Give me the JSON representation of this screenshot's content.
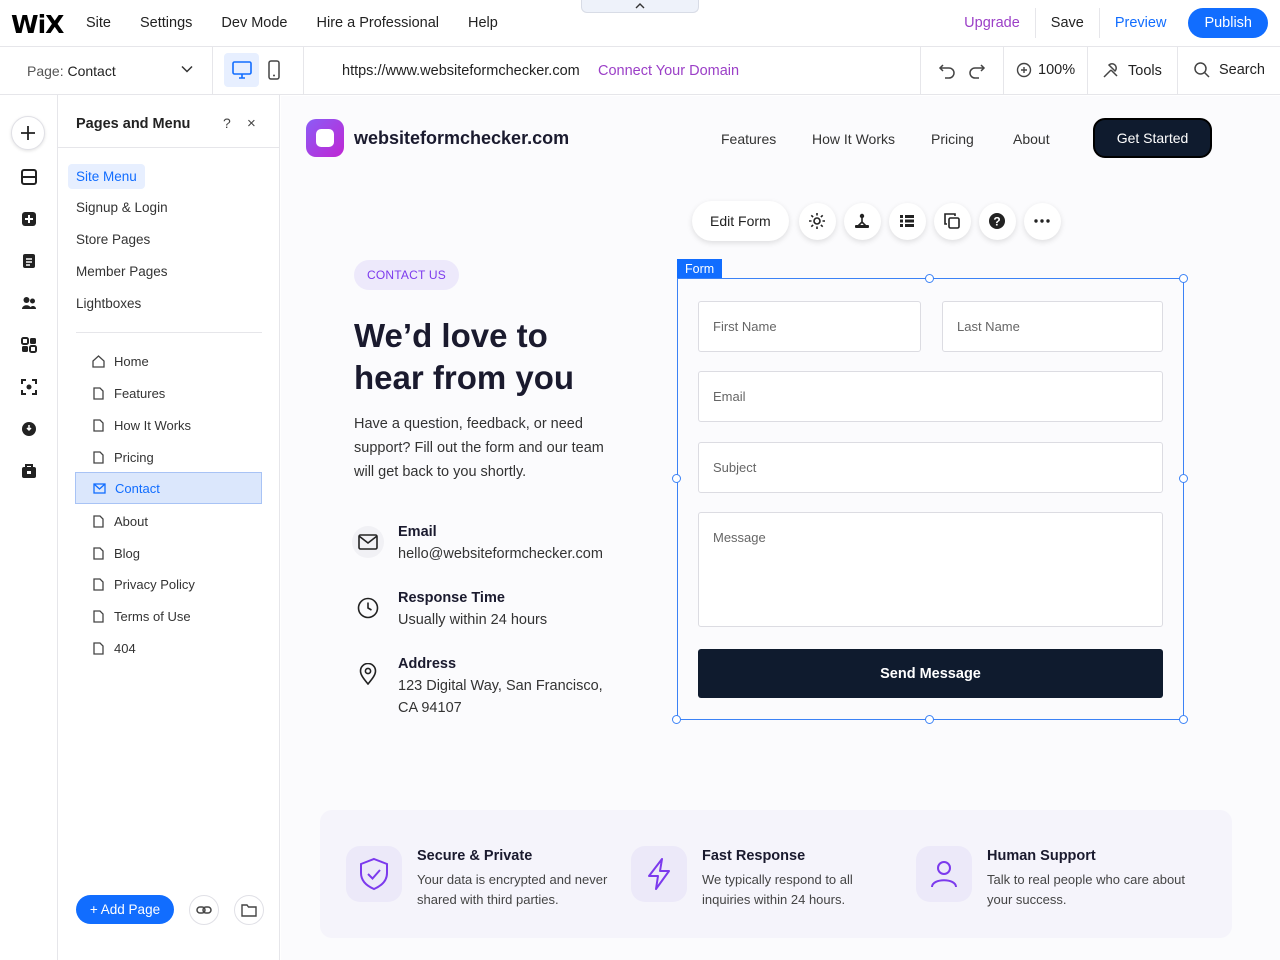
{
  "editor": {
    "logo": "WiX",
    "nav": [
      "Site",
      "Settings",
      "Dev Mode",
      "Hire a Professional",
      "Help"
    ],
    "upgrade": "Upgrade",
    "save": "Save",
    "preview": "Preview",
    "publish": "Publish",
    "page_prefix": "Page:",
    "page_name": "Contact",
    "url": "https://www.websiteformchecker.com",
    "connect_domain": "Connect Your Domain",
    "zoom": "100%",
    "tools": "Tools",
    "search": "Search"
  },
  "panel": {
    "title": "Pages and Menu",
    "help": "?",
    "close": "×",
    "categories": [
      "Site Menu",
      "Signup & Login",
      "Store Pages",
      "Member Pages",
      "Lightboxes"
    ],
    "pages": [
      "Home",
      "Features",
      "How It Works",
      "Pricing",
      "Contact",
      "About",
      "Blog",
      "Privacy Policy",
      "Terms of Use",
      "404"
    ],
    "active_page": "Contact",
    "add_page": "+ Add Page"
  },
  "site": {
    "name": "websiteformchecker.com",
    "nav": [
      "Features",
      "How It Works",
      "Pricing",
      "About"
    ],
    "cta": "Get Started",
    "badge": "CONTACT US",
    "headline": "We’d love to hear from you",
    "intro": "Have a question, feedback, or need support? Fill out the form and our team will get back to you shortly.",
    "info": [
      {
        "title": "Email",
        "text": "hello@websiteformchecker.com",
        "icon": "mail-icon"
      },
      {
        "title": "Response Time",
        "text": "Usually within 24 hours",
        "icon": "clock-icon"
      },
      {
        "title": "Address",
        "text": "123 Digital Way, San Francisco, CA 94107",
        "icon": "location-pin-icon"
      }
    ],
    "form_toolbar": {
      "edit": "Edit Form"
    },
    "form_label": "Form",
    "form": {
      "first_name": "First Name",
      "last_name": "Last Name",
      "email": "Email",
      "subject": "Subject",
      "message": "Message",
      "submit": "Send Message"
    },
    "features": [
      {
        "title": "Secure & Private",
        "text": "Your data is encrypted and never shared with third parties.",
        "icon": "shield-check-icon"
      },
      {
        "title": "Fast Response",
        "text": "We typically respond to all inquiries within 24 hours.",
        "icon": "lightning-icon"
      },
      {
        "title": "Human Support",
        "text": "Talk to real people who care about your success.",
        "icon": "user-icon"
      }
    ]
  },
  "colors": {
    "accent": "#116dff",
    "brand_purple": "#9b3fc7",
    "dark": "#0f1b2e"
  }
}
